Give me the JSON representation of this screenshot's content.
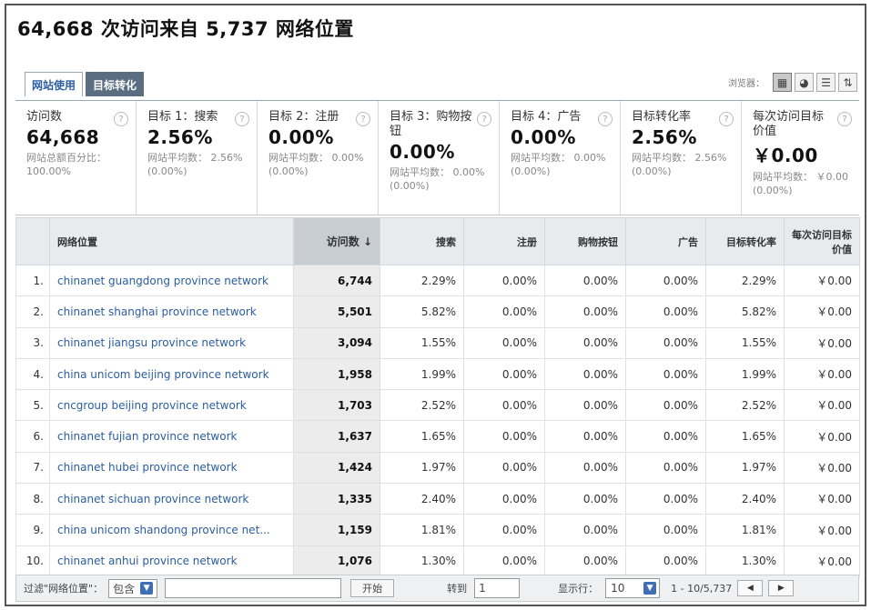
{
  "page": {
    "title": "64,668 次访问来自 5,737 网络位置"
  },
  "tabs": [
    {
      "label": "网站使用",
      "active": false
    },
    {
      "label": "目标转化",
      "active": true
    }
  ],
  "view": {
    "label": "浏览器：",
    "buttons": [
      {
        "icon": "table-icon",
        "glyph": "▦"
      },
      {
        "icon": "pie-chart-icon",
        "glyph": "◕"
      },
      {
        "icon": "bar-list-icon",
        "glyph": "☰"
      },
      {
        "icon": "compare-icon",
        "glyph": "⇅"
      }
    ]
  },
  "summary": [
    {
      "label": "访问数",
      "value": "64,668",
      "sub": "网站总额百分比： 100.00%"
    },
    {
      "label": "目标 1：搜索",
      "value": "2.56%",
      "sub": "网站平均数： 2.56% (0.00%)"
    },
    {
      "label": "目标 2：注册",
      "value": "0.00%",
      "sub": "网站平均数： 0.00% (0.00%)"
    },
    {
      "label": "目标 3：购物按钮",
      "value": "0.00%",
      "sub": "网站平均数： 0.00% (0.00%)"
    },
    {
      "label": "目标 4：广告",
      "value": "0.00%",
      "sub": "网站平均数： 0.00% (0.00%)"
    },
    {
      "label": "目标转化率",
      "value": "2.56%",
      "sub": "网站平均数： 2.56% (0.00%)"
    },
    {
      "label": "每次访问目标价值",
      "value": "￥0.00",
      "sub": "网站平均数： ￥0.00 (0.00%)"
    }
  ],
  "table": {
    "headers": [
      "网络位置",
      "访问数 ↓",
      "搜索",
      "注册",
      "购物按钮",
      "广告",
      "目标转化率",
      "每次访问目标价值"
    ],
    "rows": [
      {
        "idx": "1.",
        "name": "chinanet guangdong province network",
        "visits": "6,744",
        "c1": "2.29%",
        "c2": "0.00%",
        "c3": "0.00%",
        "c4": "0.00%",
        "rate": "2.29%",
        "value": "￥0.00"
      },
      {
        "idx": "2.",
        "name": "chinanet shanghai province network",
        "visits": "5,501",
        "c1": "5.82%",
        "c2": "0.00%",
        "c3": "0.00%",
        "c4": "0.00%",
        "rate": "5.82%",
        "value": "￥0.00"
      },
      {
        "idx": "3.",
        "name": "chinanet jiangsu province network",
        "visits": "3,094",
        "c1": "1.55%",
        "c2": "0.00%",
        "c3": "0.00%",
        "c4": "0.00%",
        "rate": "1.55%",
        "value": "￥0.00"
      },
      {
        "idx": "4.",
        "name": "china unicom beijing province network",
        "visits": "1,958",
        "c1": "1.99%",
        "c2": "0.00%",
        "c3": "0.00%",
        "c4": "0.00%",
        "rate": "1.99%",
        "value": "￥0.00"
      },
      {
        "idx": "5.",
        "name": "cncgroup beijing province network",
        "visits": "1,703",
        "c1": "2.52%",
        "c2": "0.00%",
        "c3": "0.00%",
        "c4": "0.00%",
        "rate": "2.52%",
        "value": "￥0.00"
      },
      {
        "idx": "6.",
        "name": "chinanet fujian province network",
        "visits": "1,637",
        "c1": "1.65%",
        "c2": "0.00%",
        "c3": "0.00%",
        "c4": "0.00%",
        "rate": "1.65%",
        "value": "￥0.00"
      },
      {
        "idx": "7.",
        "name": "chinanet hubei province network",
        "visits": "1,424",
        "c1": "1.97%",
        "c2": "0.00%",
        "c3": "0.00%",
        "c4": "0.00%",
        "rate": "1.97%",
        "value": "￥0.00"
      },
      {
        "idx": "8.",
        "name": "chinanet sichuan province network",
        "visits": "1,335",
        "c1": "2.40%",
        "c2": "0.00%",
        "c3": "0.00%",
        "c4": "0.00%",
        "rate": "2.40%",
        "value": "￥0.00"
      },
      {
        "idx": "9.",
        "name": "china unicom shandong province net...",
        "visits": "1,159",
        "c1": "1.81%",
        "c2": "0.00%",
        "c3": "0.00%",
        "c4": "0.00%",
        "rate": "1.81%",
        "value": "￥0.00"
      },
      {
        "idx": "10.",
        "name": "chinanet anhui province network",
        "visits": "1,076",
        "c1": "1.30%",
        "c2": "0.00%",
        "c3": "0.00%",
        "c4": "0.00%",
        "rate": "1.30%",
        "value": "￥0.00"
      }
    ]
  },
  "footer": {
    "filter_label": "过滤\"网络位置\"：",
    "filter_mode": "包含",
    "filter_value": "",
    "go_label": "开始",
    "goto_label": "转到",
    "page": "1",
    "show_label": "显示行：",
    "rows_per_page": "10",
    "range": "1 - 10/5,737",
    "prev": "◀",
    "next": "▶"
  }
}
